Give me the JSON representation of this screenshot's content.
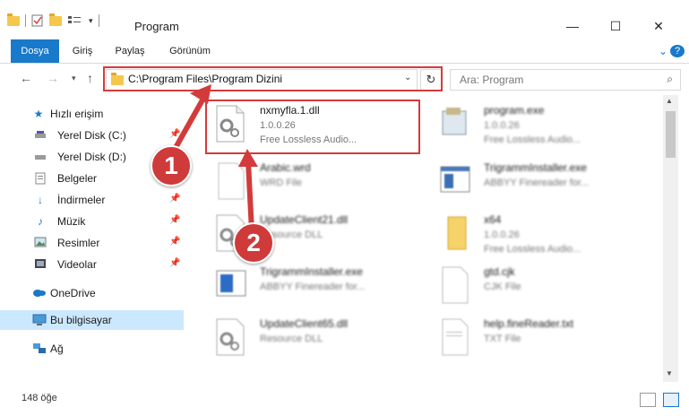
{
  "window": {
    "title": "Program",
    "controls": {
      "minimize": "—",
      "maximize": "☐",
      "close": "✕",
      "help": "?"
    }
  },
  "ribbon": {
    "tabs": [
      "Dosya",
      "Giriş",
      "Paylaş",
      "Görünüm"
    ]
  },
  "navigation": {
    "address": "C:\\Program Files\\Program Dizini",
    "search_placeholder": "Ara: Program"
  },
  "sidebar": {
    "items": [
      {
        "label": "Hızlı erişim",
        "icon": "star-icon",
        "pinned": false
      },
      {
        "label": "Yerel Disk (C:)",
        "icon": "drive-icon",
        "pinned": true
      },
      {
        "label": "Yerel Disk (D:)",
        "icon": "drive-icon",
        "pinned": false
      },
      {
        "label": "Belgeler",
        "icon": "document-icon",
        "pinned": true
      },
      {
        "label": "İndirmeler",
        "icon": "download-icon",
        "pinned": true
      },
      {
        "label": "Müzik",
        "icon": "music-icon",
        "pinned": true
      },
      {
        "label": "Resimler",
        "icon": "pictures-icon",
        "pinned": true
      },
      {
        "label": "Videolar",
        "icon": "video-icon",
        "pinned": true
      },
      {
        "label": "OneDrive",
        "icon": "cloud-icon",
        "pinned": false
      },
      {
        "label": "Bu bilgisayar",
        "icon": "computer-icon",
        "pinned": false
      },
      {
        "label": "Ağ",
        "icon": "network-icon",
        "pinned": false
      }
    ]
  },
  "files": [
    {
      "name": "nxmyfla.1.dll",
      "line1": "1.0.0.26",
      "line2": "Free Lossless Audio...",
      "icon": "dll-gear-icon"
    },
    {
      "name": "program.exe",
      "line1": "1.0.0.26",
      "line2": "Free Lossless Audio...",
      "icon": "exe-icon"
    },
    {
      "name": "Arabic.wrd",
      "line1": "WRD File",
      "line2": "",
      "icon": "blank-file-icon"
    },
    {
      "name": "TrigrammInstaller.exe",
      "line1": "ABBYY Finereader for...",
      "line2": "",
      "icon": "exe-window-icon"
    },
    {
      "name": "UpdateClient21.dll",
      "line1": "Resource DLL",
      "line2": "",
      "icon": "dll-gear-icon"
    },
    {
      "name": "x64",
      "line1": "1.0.0.26",
      "line2": "Free Lossless Audio...",
      "icon": "folder-file-icon"
    },
    {
      "name": "TrigrammInstaller.exe",
      "line1": "ABBYY Finereader for...",
      "line2": "",
      "icon": "exe-blue-icon"
    },
    {
      "name": "gtd.cjk",
      "line1": "CJK File",
      "line2": "",
      "icon": "blank-file-icon"
    },
    {
      "name": "UpdateClient65.dll",
      "line1": "Resource DLL",
      "line2": "",
      "icon": "dll-gear-icon"
    },
    {
      "name": "help.fineReader.txt",
      "line1": "TXT File",
      "line2": "",
      "icon": "txt-file-icon"
    }
  ],
  "status": {
    "count": "148 öğe"
  },
  "callouts": [
    "1",
    "2"
  ],
  "colors": {
    "accent": "#1979ca",
    "highlight": "#d33b3b",
    "selection": "#cce8ff"
  }
}
